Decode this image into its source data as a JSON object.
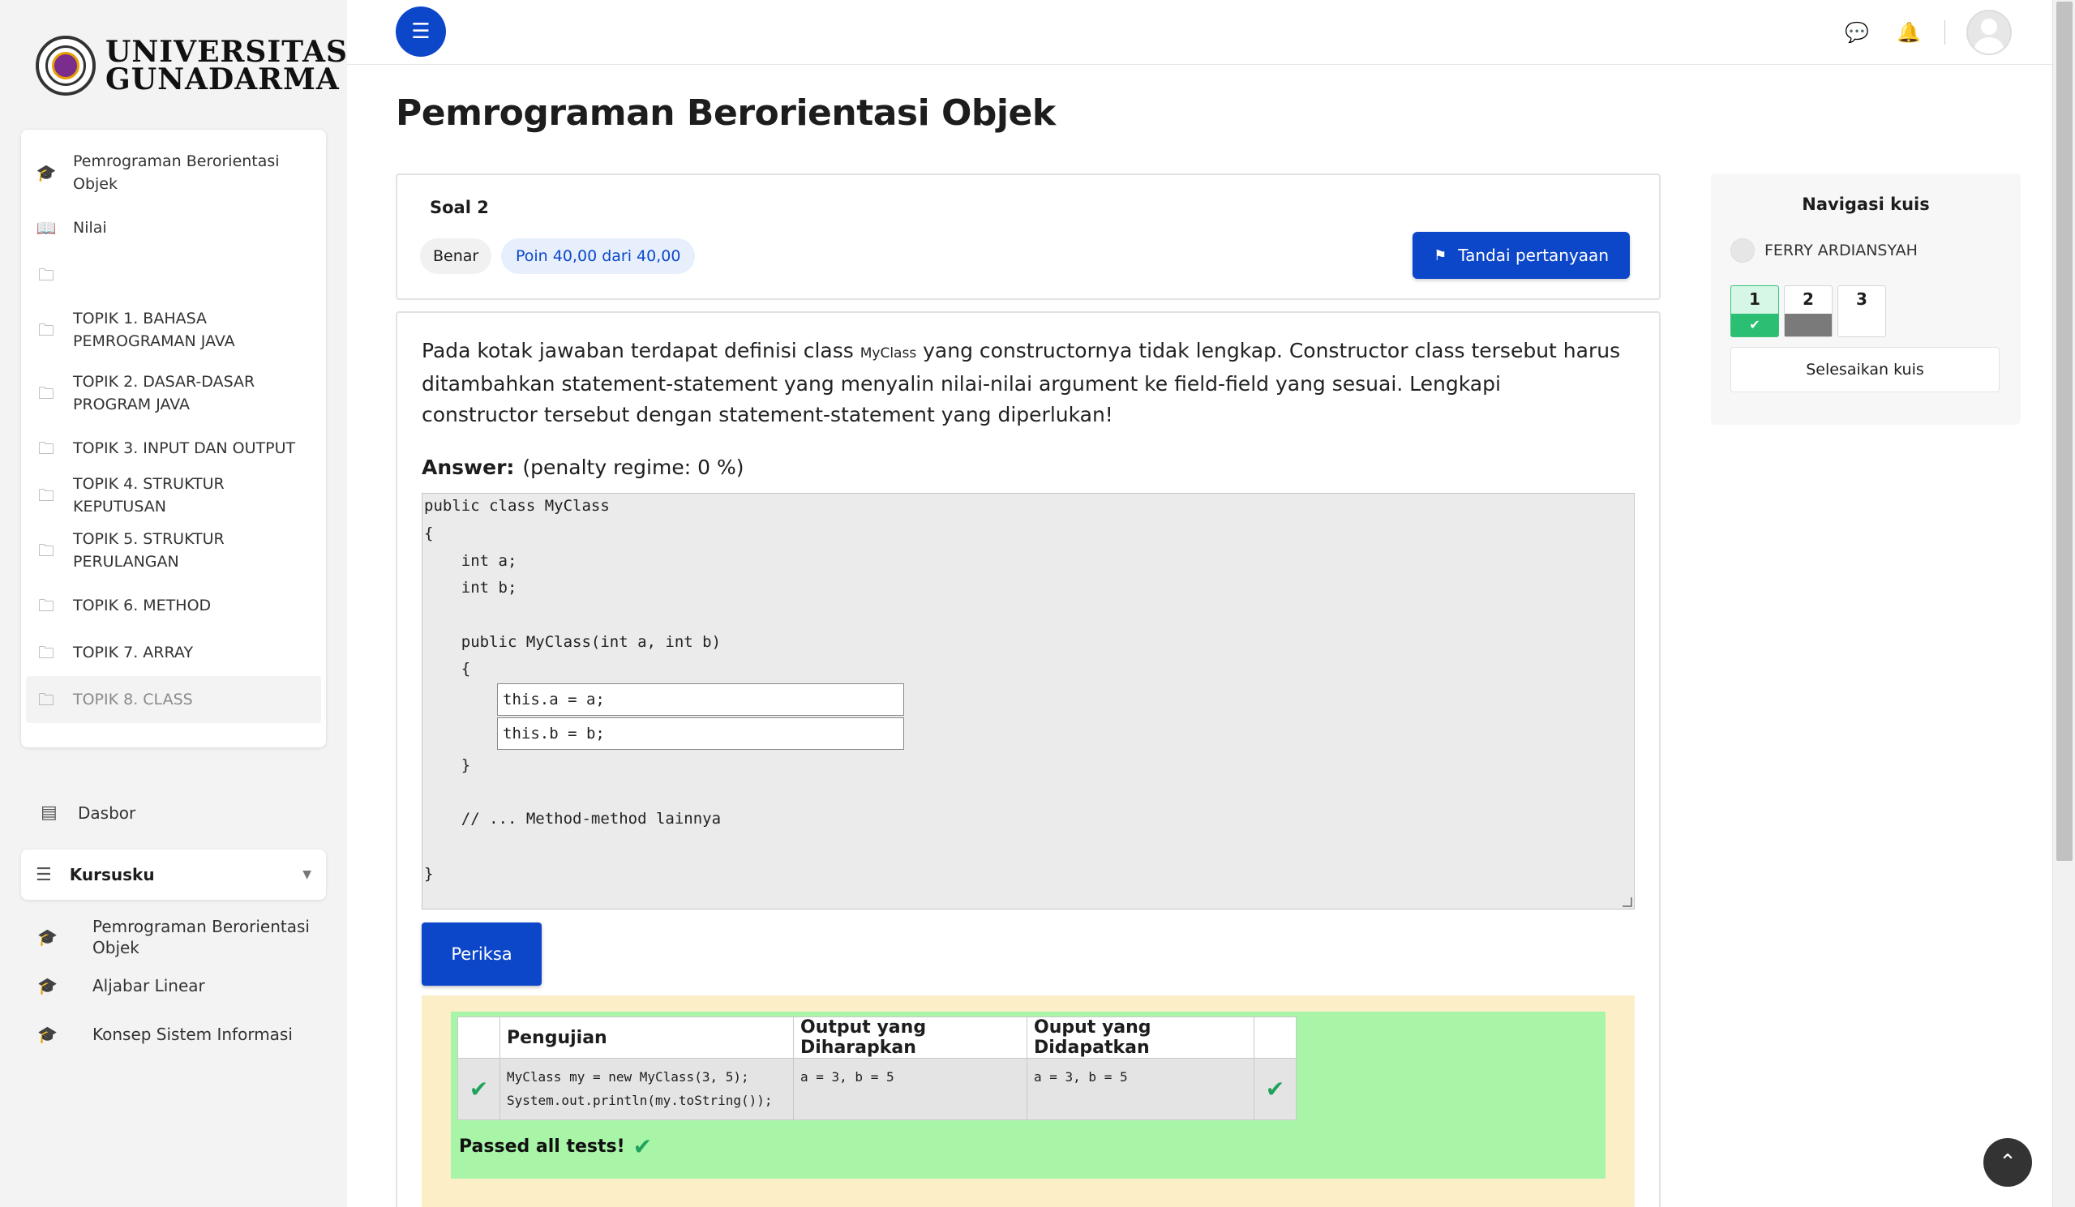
{
  "brand": {
    "logo_text_line1": "UNIVERSITAS",
    "logo_text_line2": "GUNADARMA"
  },
  "sidebar": {
    "course_items": [
      {
        "label": "Pemrograman Berorientasi Objek",
        "icon": "graduation-cap-icon"
      },
      {
        "label": "Nilai",
        "icon": "book-icon"
      },
      {
        "label": "",
        "icon": "folder-icon"
      },
      {
        "label": "TOPIK 1. BAHASA PEMROGRAMAN JAVA",
        "icon": "folder-icon"
      },
      {
        "label": "TOPIK 2. DASAR-DASAR PROGRAM JAVA",
        "icon": "folder-icon"
      },
      {
        "label": "TOPIK 3. INPUT DAN OUTPUT",
        "icon": "folder-icon"
      },
      {
        "label": "TOPIK 4. STRUKTUR KEPUTUSAN",
        "icon": "folder-icon"
      },
      {
        "label": "TOPIK 5. STRUKTUR PERULANGAN",
        "icon": "folder-icon"
      },
      {
        "label": "TOPIK 6. METHOD",
        "icon": "folder-icon"
      },
      {
        "label": "TOPIK 7. ARRAY",
        "icon": "folder-icon"
      },
      {
        "label": "TOPIK 8. CLASS",
        "icon": "folder-icon",
        "active": true
      }
    ],
    "dasbor": "Dasbor",
    "kursusku": "Kursusku",
    "my_courses": [
      "Pemrograman Berorientasi Objek",
      "Aljabar Linear",
      "Konsep Sistem Informasi"
    ]
  },
  "page": {
    "title": "Pemrograman Berorientasi Objek"
  },
  "question": {
    "number_label": "Soal 2",
    "status": "Benar",
    "points": "Poin 40,00 dari 40,00",
    "flag_label": "Tandai pertanyaan",
    "text_part1": "Pada kotak jawaban terdapat definisi class ",
    "text_code": "MyClass",
    "text_part2": " yang constructornya tidak lengkap.  Constructor class tersebut harus ditambahkan statement-statement yang menyalin nilai-nilai argument ke field-field yang sesuai. Lengkapi constructor tersebut dengan statement-statement yang diperlukan!",
    "answer_label": "Answer:",
    "penalty": "(penalty regime: 0 %)",
    "code_lines": [
      "public class MyClass",
      "{",
      "    int a;",
      "    int b;",
      "",
      "    public MyClass(int a, int b)",
      "    {",
      "    }",
      "",
      "    // ... Method-method lainnya",
      "",
      "}"
    ],
    "inputs": [
      "this.a = a;",
      "this.b = b;"
    ],
    "check_label": "Periksa"
  },
  "results": {
    "headers": [
      "",
      "Pengujian",
      "Output yang Diharapkan",
      "Ouput yang Didapatkan",
      ""
    ],
    "rows": [
      {
        "test_line1": "MyClass my = new MyClass(3, 5);",
        "test_line2": "System.out.println(my.toString());",
        "expected": "a = 3, b = 5",
        "got": "a = 3, b = 5"
      }
    ],
    "passed": "Passed all tests!",
    "pass_color": "#1fa35c"
  },
  "quiz_nav": {
    "title": "Navigasi kuis",
    "user": "FERRY ARDIANSYAH",
    "questions": [
      {
        "num": "1",
        "state": "correct"
      },
      {
        "num": "2",
        "state": "current"
      },
      {
        "num": "3",
        "state": "unanswered"
      }
    ],
    "finish_label": "Selesaikan kuis"
  },
  "colors": {
    "accent": "#0d47c9",
    "feedback_bg": "#fcefc7",
    "result_bg": "#a8f5a8"
  }
}
